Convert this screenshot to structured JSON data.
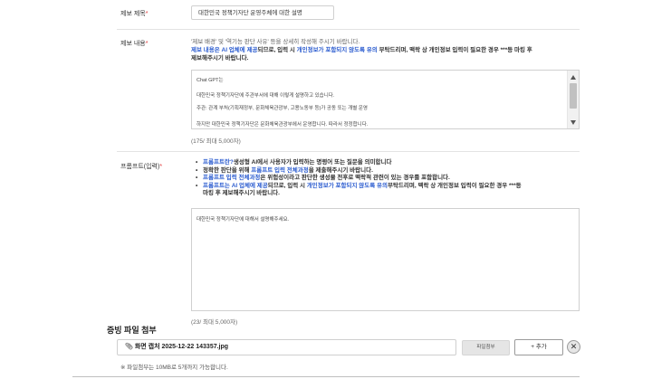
{
  "title_field": {
    "label": "제보 제목",
    "required_mark": "*",
    "value": "대한민국 정책기자단 운영주체에 대한 설명"
  },
  "content_field": {
    "label": "제보 내용",
    "required_mark": "*",
    "guide_line1": "'제보 배경' 및 '역기능 판단 사유' 등을 상세히 작성해 주시기 바랍니다.",
    "guide_line2_blue1": "제보 내용은 AI 업체에 제공",
    "guide_line2_bold1": "되므로, 입력 시 ",
    "guide_line2_blue2": "개인정보가 포함되지 않도록 유의",
    "guide_line2_bold2": " 부탁드리며, 맥락 상 개인정보 입력이 필요한 경우 ***등 마킹 후",
    "guide_line3": "제보해주시기 바랍니다.",
    "text_lines": [
      "Chat GPT는",
      "대한민국 정책기자단에 주관부서에 대해 이렇게 설명하고 있습니다.",
      "주관: 관계 부처(기획재정부, 문화체육관광부, 고용노동부 등)가 공동 또는 개별 운영",
      "하지만 대한민국 정책기자단은 문화체육관광부에서 운영합니다. 따라서 정정합니다."
    ],
    "counter": "(175/ 최대 5,000자)"
  },
  "prompt_field": {
    "label": "프롬프트(입력)",
    "required_mark": "*",
    "bullet1_blue": "프롬프트란?",
    "bullet1_rest": "생성형 AI에서 사용자가 입력하는 명령어 또는 질문을 의미합니다",
    "bullet2_a": "정확한 판단을 위해 ",
    "bullet2_blue": "프롬프트 입력 전체과정",
    "bullet2_b": "을 제출해주시기 바랍니다.",
    "bullet3_blue": "프롬프트 입력 전체과정",
    "bullet3_rest": "은 위험성이라고 판단한 생성물 전후로 맥락적 관련이 있는 경우를 포함합니다.",
    "bullet4_blue1": "프롬프트는 AI 업체에 제공",
    "bullet4_a": "되므로, 입력 시 ",
    "bullet4_blue2": "개인정보가 포함되지 않도록 유의",
    "bullet4_b": "부탁드리며, 맥락 상 개인정보 입력이 필요한 경우 ***등",
    "bullet4_c": "마킹 후 제보해주시기 바랍니다.",
    "value": "대한민국 정책기자단에 대해서 설명해주세요.",
    "counter": "(23/ 최대 5,000자)"
  },
  "attachment": {
    "section_title": "증빙 파일 첨부",
    "file_name": "화면 캡처 2025-12-22 143357.jpg",
    "attach_button": "파일첨부",
    "add_button": "+ 추가",
    "remove_button": "✕",
    "note": "※ 파일첨부는 10MB로 5개까지 가능합니다."
  },
  "colors": {
    "accent_blue": "#2f5fd0",
    "required_red": "#e03a3a"
  },
  "icons": {
    "file": "paperclip-icon",
    "remove": "close-icon",
    "scroll_up": "triangle-up-icon",
    "scroll_down": "triangle-down-icon"
  }
}
